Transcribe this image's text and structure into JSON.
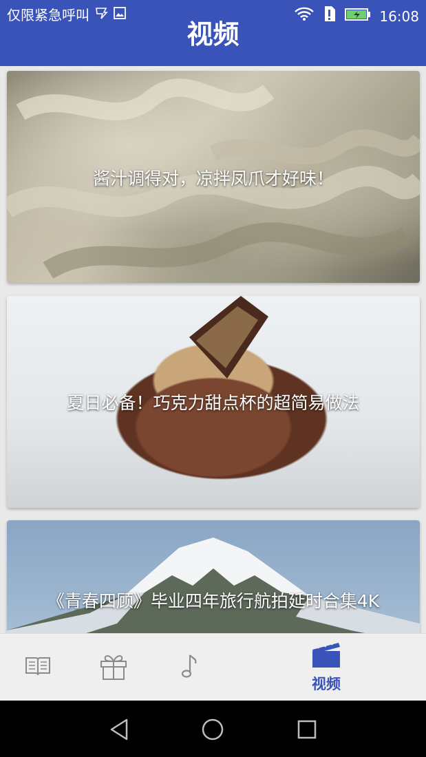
{
  "status_bar": {
    "left_text": "仅限紧急呼叫",
    "time": "16:08",
    "icons": [
      "sim-icon",
      "image-icon",
      "wifi-icon",
      "sim-alert-icon",
      "battery-charging-icon"
    ]
  },
  "app_bar": {
    "title": "视频"
  },
  "videos": [
    {
      "title": "酱汁调得对，凉拌凤爪才好味！"
    },
    {
      "title": "夏日必备！巧克力甜点杯的超简易做法"
    },
    {
      "title": "《青春四顾》毕业四年旅行航拍延时合集4K"
    }
  ],
  "bottom_nav": {
    "tabs": [
      {
        "icon": "book-icon",
        "label": ""
      },
      {
        "icon": "gift-icon",
        "label": ""
      },
      {
        "icon": "music-note-icon",
        "label": ""
      },
      {
        "icon": "clapperboard-icon",
        "label": "视频",
        "active": true
      }
    ]
  },
  "colors": {
    "primary": "#3a53b8",
    "nav_bg": "#efefef",
    "inactive_icon": "#8a8a8a"
  }
}
